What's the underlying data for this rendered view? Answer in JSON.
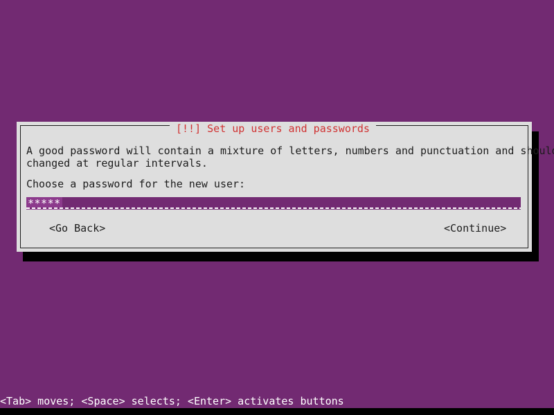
{
  "screen": {
    "background_color": "#722a72"
  },
  "dialog": {
    "title": "[!!] Set up users and passwords",
    "title_color": "#d03232",
    "background_color": "#dedede",
    "border_color": "#1c1c1c",
    "body": {
      "line1": "A good password will contain a mixture of letters, numbers and punctuation and should be",
      "line2": "changed at regular intervals.",
      "prompt": "Choose a password for the new user:"
    },
    "password_input": {
      "value": "*****",
      "masked": true,
      "field_color": "#722a72",
      "cursor_color": "#8c3a8c",
      "text_color": "#ffffff"
    },
    "buttons": {
      "go_back": "<Go Back>",
      "continue": "<Continue>"
    }
  },
  "statusbar": {
    "text": "<Tab> moves; <Space> selects; <Enter> activates buttons",
    "text_color": "#ffffff"
  }
}
